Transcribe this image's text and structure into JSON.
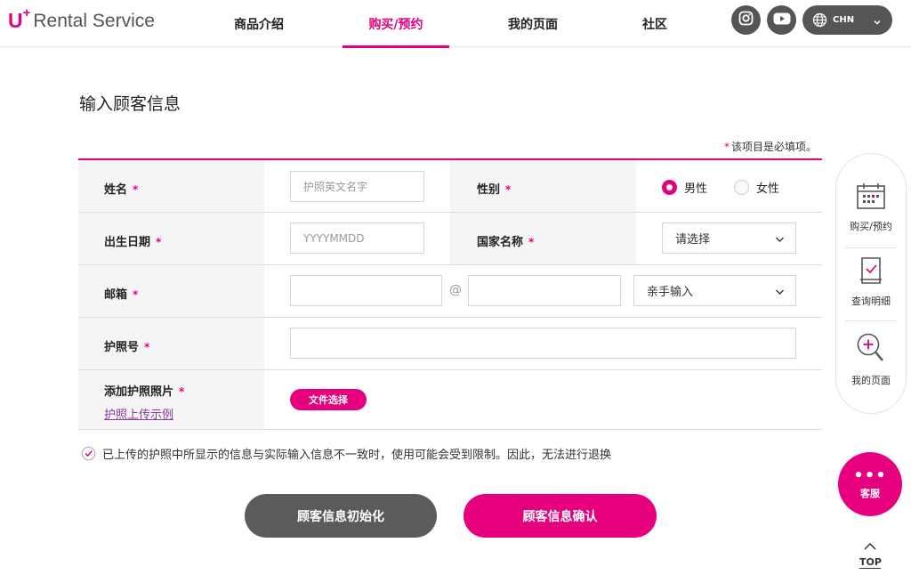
{
  "header": {
    "logo_u": "U",
    "logo_plus": "+",
    "logo_text": "Rental Service",
    "nav": [
      "商品介绍",
      "购买/预约",
      "我的页面",
      "社区"
    ],
    "active_nav": "购买/预约",
    "lang_label": "CHN"
  },
  "page": {
    "title": "输入顾客信息",
    "required_note_star": "*",
    "required_note": "该项目是必填项。"
  },
  "form": {
    "name_label": "姓名",
    "name_placeholder": "护照英文名字",
    "gender_label": "性别",
    "gender_options": [
      "男性",
      "女性"
    ],
    "gender_selected": "男性",
    "birth_label": "出生日期",
    "birth_placeholder": "YYYYMMDD",
    "country_label": "国家名称",
    "country_selected": "请选择",
    "email_label": "邮箱",
    "email_at": "@",
    "email_domain_selected": "亲手输入",
    "passport_label": "护照号",
    "photo_label": "添加护照照片",
    "file_button": "文件选择",
    "example_link": "护照上传示例",
    "required_star": "*"
  },
  "notice": "已上传的护照中所显示的信息与实际输入信息不一致时，使用可能会受到限制。因此，无法进行退换",
  "buttons": {
    "reset": "顾客信息初始化",
    "confirm": "顾客信息确认"
  },
  "quick_menu": {
    "items": [
      "购买/预约",
      "查询明细",
      "我的页面"
    ]
  },
  "service": {
    "dots": "•••",
    "label": "客服"
  },
  "top_label": "TOP",
  "colors": {
    "accent": "#e6007e",
    "dark_button": "#5b5b5b",
    "header_icon_bg": "#555555"
  }
}
